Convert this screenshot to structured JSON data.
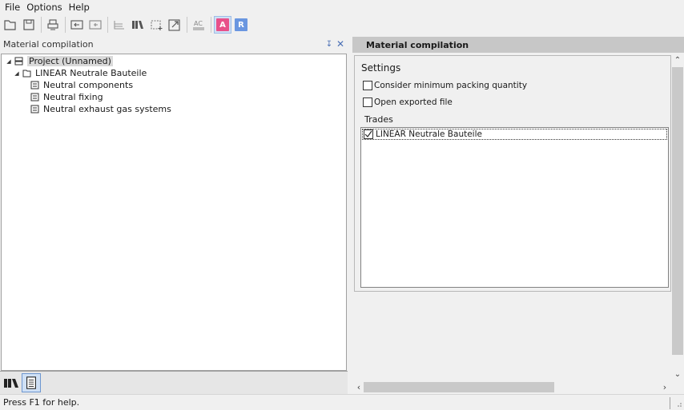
{
  "menu": {
    "file": "File",
    "options": "Options",
    "help": "Help"
  },
  "toolbar": {
    "icons": [
      "open-folder-icon",
      "save-icon",
      "print-icon",
      "import-icon",
      "export-icon",
      "tree-view-icon",
      "library-icon",
      "selection-icon",
      "external-link-icon",
      "text-replace-icon",
      "mode-a-button",
      "mode-r-button"
    ],
    "mode_a_label": "A",
    "mode_r_label": "R",
    "mode_a_color": "#e8508a",
    "mode_r_color": "#6a96e0"
  },
  "left_panel": {
    "title": "Material compilation",
    "pin_glyph": "↧",
    "close_glyph": "✕",
    "tree": {
      "project": "Project (Unnamed)",
      "group": "LINEAR Neutrale Bauteile",
      "items": [
        "Neutral components",
        "Neutral fixing",
        "Neutral exhaust gas systems"
      ]
    }
  },
  "right_panel": {
    "title": "Material compilation",
    "settings_title": "Settings",
    "options": [
      {
        "label": "Consider minimum packing quantity",
        "checked": false
      },
      {
        "label": "Open exported file",
        "checked": false
      }
    ],
    "trades_label": "Trades",
    "trades": [
      {
        "label": "LINEAR Neutrale Bauteile",
        "checked": true
      }
    ]
  },
  "status": {
    "text": "Press F1 for help."
  }
}
